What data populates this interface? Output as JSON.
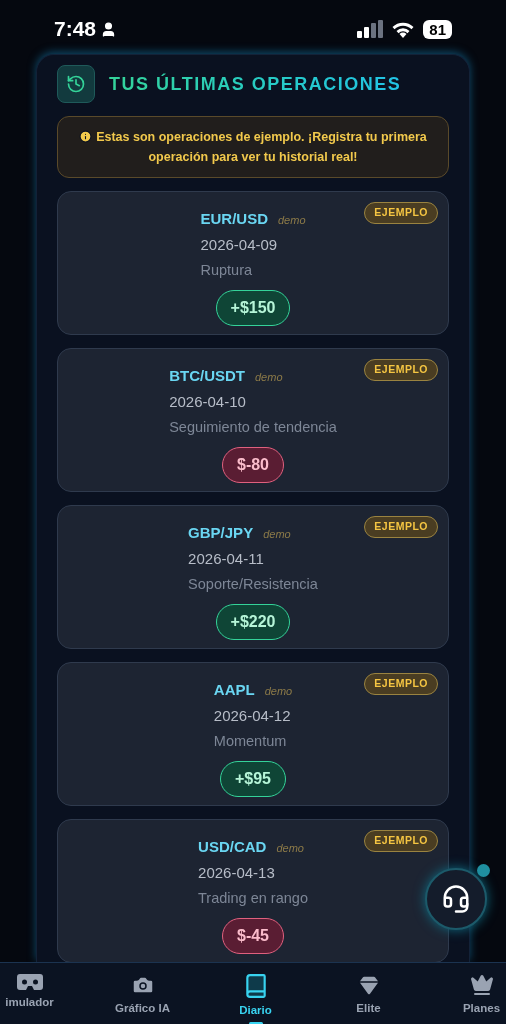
{
  "status_bar": {
    "time": "7:48",
    "battery": "81"
  },
  "header": {
    "title": "TUS ÚLTIMAS OPERACIONES"
  },
  "notice": {
    "text": "Estas son operaciones de ejemplo. ¡Registra tu primera operación para ver tu historial real!"
  },
  "trades": [
    {
      "pair": "EUR/USD",
      "tag": "demo",
      "date": "2026-04-09",
      "strategy": "Ruptura",
      "pnl": "+$150",
      "kind": "gain",
      "badge": "EJEMPLO"
    },
    {
      "pair": "BTC/USDT",
      "tag": "demo",
      "date": "2026-04-10",
      "strategy": "Seguimiento de tendencia",
      "pnl": "$-80",
      "kind": "loss",
      "badge": "EJEMPLO"
    },
    {
      "pair": "GBP/JPY",
      "tag": "demo",
      "date": "2026-04-11",
      "strategy": "Soporte/Resistencia",
      "pnl": "+$220",
      "kind": "gain",
      "badge": "EJEMPLO"
    },
    {
      "pair": "AAPL",
      "tag": "demo",
      "date": "2026-04-12",
      "strategy": "Momentum",
      "pnl": "+$95",
      "kind": "gain",
      "badge": "EJEMPLO"
    },
    {
      "pair": "USD/CAD",
      "tag": "demo",
      "date": "2026-04-13",
      "strategy": "Trading en rango",
      "pnl": "$-45",
      "kind": "loss",
      "badge": "EJEMPLO"
    }
  ],
  "nav": [
    {
      "label": "imulador",
      "kind": "goggles",
      "selected": false
    },
    {
      "label": "Gráfico IA",
      "kind": "camera",
      "selected": false
    },
    {
      "label": "Diario",
      "kind": "book",
      "selected": true
    },
    {
      "label": "Elite",
      "kind": "gem",
      "selected": false
    },
    {
      "label": "Planes",
      "kind": "crown",
      "selected": false
    }
  ]
}
